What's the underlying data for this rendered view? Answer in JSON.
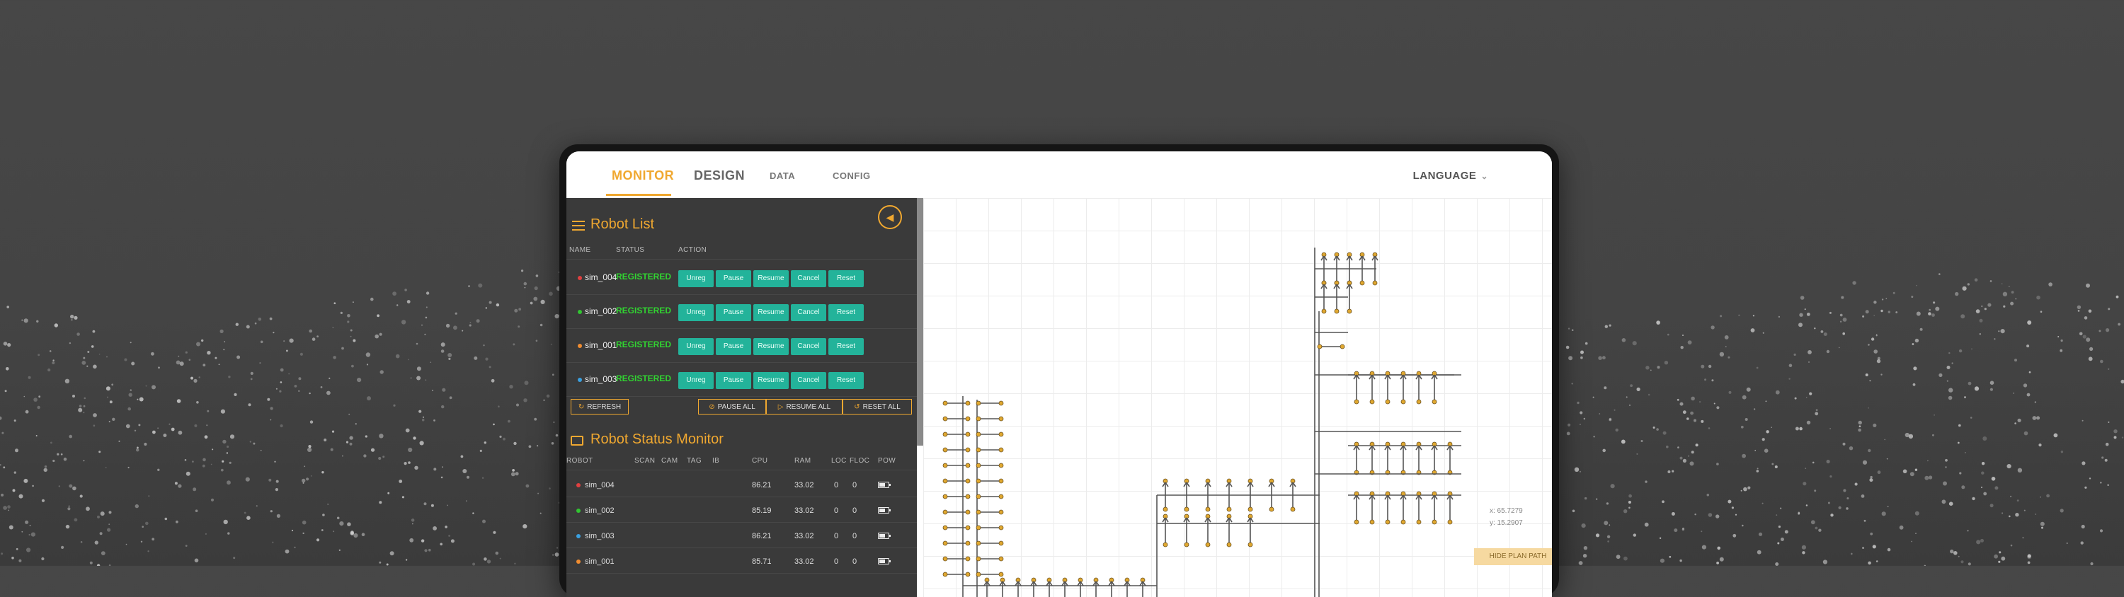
{
  "nav": {
    "tabs": [
      {
        "label": "MONITOR",
        "active": true
      },
      {
        "label": "DESIGN",
        "active": false
      },
      {
        "label": "DATA",
        "active": false
      },
      {
        "label": "CONFIG",
        "active": false
      }
    ],
    "language_label": "LANGUAGE"
  },
  "robot_list": {
    "title": "Robot List",
    "columns": [
      "NAME",
      "STATUS",
      "ACTION"
    ],
    "rows": [
      {
        "name": "sim_004",
        "status": "REGISTERED",
        "dot_color": "#e04040"
      },
      {
        "name": "sim_002",
        "status": "REGISTERED",
        "dot_color": "#31c431"
      },
      {
        "name": "sim_001",
        "status": "REGISTERED",
        "dot_color": "#f08c30"
      },
      {
        "name": "sim_003",
        "status": "REGISTERED",
        "dot_color": "#3aa0e0"
      }
    ],
    "actions": [
      "Unreg",
      "Pause",
      "Resume",
      "Cancel",
      "Reset"
    ],
    "refresh_label": "REFRESH",
    "pause_all_label": "PAUSE ALL",
    "resume_all_label": "RESUME ALL",
    "reset_all_label": "RESET ALL"
  },
  "status_monitor": {
    "title": "Robot Status Monitor",
    "columns": [
      "ROBOT",
      "SCAN",
      "CAM",
      "TAG",
      "IB",
      "CPU",
      "RAM",
      "LOC",
      "FLOC",
      "POW"
    ],
    "rows": [
      {
        "robot": "sim_004",
        "cpu": "86.21",
        "ram": "33.02",
        "loc": "0",
        "floc": "0",
        "dot_color": "#e04040"
      },
      {
        "robot": "sim_002",
        "cpu": "85.19",
        "ram": "33.02",
        "loc": "0",
        "floc": "0",
        "dot_color": "#31c431"
      },
      {
        "robot": "sim_003",
        "cpu": "86.21",
        "ram": "33.02",
        "loc": "0",
        "floc": "0",
        "dot_color": "#3aa0e0"
      },
      {
        "robot": "sim_001",
        "cpu": "85.71",
        "ram": "33.02",
        "loc": "0",
        "floc": "0",
        "dot_color": "#f08c30"
      }
    ]
  },
  "map": {
    "coord_x": "x: 65.7279",
    "coord_y": "y: 15.2907",
    "hide_path_label": "HIDE PLAN PATH"
  },
  "colors": {
    "accent": "#f0a830",
    "action_button": "#23b39a",
    "status_registered": "#31d331",
    "panel_bg": "#3a3a3a"
  }
}
